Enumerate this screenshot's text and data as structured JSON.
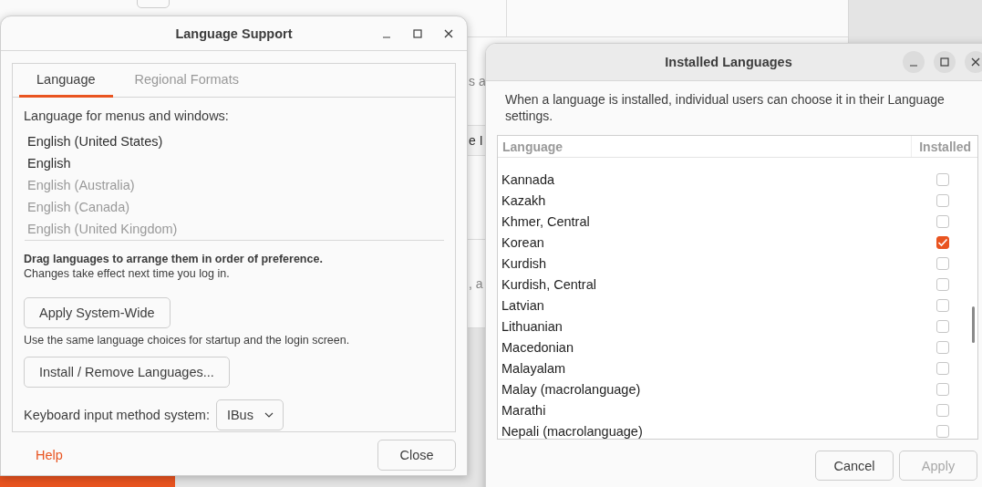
{
  "background_window": {
    "fragments": [
      "s a",
      "e I",
      ", a"
    ]
  },
  "language_support": {
    "title": "Language Support",
    "tabs": [
      {
        "label": "Language",
        "selected": true
      },
      {
        "label": "Regional Formats",
        "selected": false
      }
    ],
    "menu_label": "Language for menus and windows:",
    "languages": [
      {
        "name": "English (United States)",
        "active": true
      },
      {
        "name": "English",
        "active": true
      },
      {
        "name": "English (Australia)",
        "active": false
      },
      {
        "name": "English (Canada)",
        "active": false
      },
      {
        "name": "English (United Kingdom)",
        "active": false
      }
    ],
    "drag_hint": "Drag languages to arrange them in order of preference.",
    "changes_note": "Changes take effect next time you log in.",
    "apply_button": "Apply System-Wide",
    "apply_note": "Use the same language choices for startup and the login screen.",
    "install_button": "Install / Remove Languages...",
    "keyboard_label": "Keyboard input method system:",
    "keyboard_value": "IBus",
    "help": "Help",
    "close": "Close"
  },
  "installed_languages": {
    "title": "Installed Languages",
    "description": "When a language is installed, individual users can choose it in their Language settings.",
    "columns": [
      "Language",
      "Installed"
    ],
    "rows": [
      {
        "name": "Kannada",
        "checked": false
      },
      {
        "name": "Kazakh",
        "checked": false
      },
      {
        "name": "Khmer, Central",
        "checked": false
      },
      {
        "name": "Korean",
        "checked": true
      },
      {
        "name": "Kurdish",
        "checked": false
      },
      {
        "name": "Kurdish, Central",
        "checked": false
      },
      {
        "name": "Latvian",
        "checked": false
      },
      {
        "name": "Lithuanian",
        "checked": false
      },
      {
        "name": "Macedonian",
        "checked": false
      },
      {
        "name": "Malayalam",
        "checked": false
      },
      {
        "name": "Malay (macrolanguage)",
        "checked": false
      },
      {
        "name": "Marathi",
        "checked": false
      },
      {
        "name": "Nepali (macrolanguage)",
        "checked": false
      }
    ],
    "cancel": {
      "label": "Cancel",
      "disabled": false
    },
    "apply": {
      "label": "Apply",
      "disabled": true
    }
  }
}
